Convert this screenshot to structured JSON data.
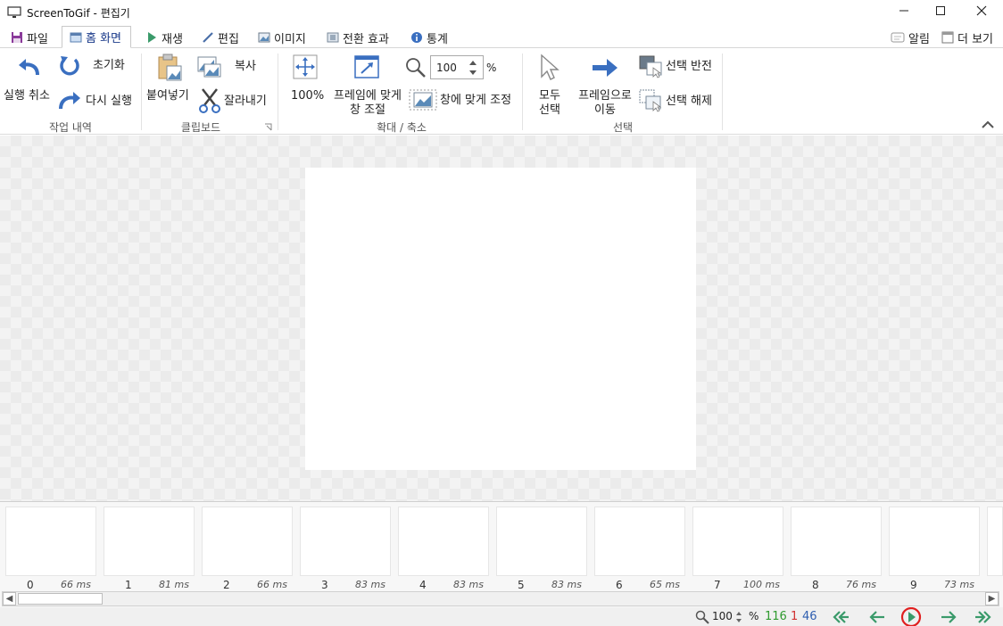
{
  "window": {
    "title": "ScreenToGif - 편집기",
    "icon": "monitor-icon",
    "controls": [
      "minimize-icon",
      "maximize-icon",
      "close-icon"
    ]
  },
  "tabs": [
    {
      "label": "파일",
      "icon": "save-icon"
    },
    {
      "label": "홈 화면",
      "icon": "home-icon",
      "active": true
    },
    {
      "label": "재생",
      "icon": "play-icon"
    },
    {
      "label": "편집",
      "icon": "pencil-icon"
    },
    {
      "label": "이미지",
      "icon": "image-icon"
    },
    {
      "label": "전환 효과",
      "icon": "transition-icon"
    },
    {
      "label": "통계",
      "icon": "info-icon"
    }
  ],
  "right_tabs": [
    {
      "label": "알림",
      "icon": "notification-icon"
    },
    {
      "label": "더 보기",
      "icon": "more-icon"
    }
  ],
  "ribbon": {
    "history": {
      "group_label": "작업 내역",
      "undo": "실행 취소",
      "reset": "초기화",
      "redo": "다시 실행"
    },
    "clipboard": {
      "group_label": "클립보드",
      "paste": "붙여넣기",
      "copy": "복사",
      "cut": "잘라내기"
    },
    "zoom": {
      "group_label": "확대 / 축소",
      "zoom_100": "100%",
      "fit_window_line1": "프레임에 맞게",
      "fit_window_line2": "창 조절",
      "zoom_value": "100",
      "percent": "%",
      "fit_image": "창에 맞게 조정"
    },
    "selection": {
      "group_label": "선택",
      "select_all_line1": "모두",
      "select_all_line2": "선택",
      "go_to_line1": "프레임으로",
      "go_to_line2": "이동",
      "invert": "선택 반전",
      "deselect": "선택 해제"
    }
  },
  "frames": [
    {
      "index": "0",
      "delay": "66 ms"
    },
    {
      "index": "1",
      "delay": "81 ms"
    },
    {
      "index": "2",
      "delay": "66 ms"
    },
    {
      "index": "3",
      "delay": "83 ms"
    },
    {
      "index": "4",
      "delay": "83 ms"
    },
    {
      "index": "5",
      "delay": "83 ms"
    },
    {
      "index": "6",
      "delay": "65 ms"
    },
    {
      "index": "7",
      "delay": "100 ms"
    },
    {
      "index": "8",
      "delay": "76 ms"
    },
    {
      "index": "9",
      "delay": "73 ms"
    }
  ],
  "statusbar": {
    "zoom_value": "100",
    "percent": "%",
    "total_frames": "116",
    "selected_count": "1",
    "current_frame": "46",
    "colors": {
      "total": "#2e9a2e",
      "selected": "#d03030",
      "current": "#2f5fb0"
    }
  },
  "colors": {
    "accent": "#2b6cc4",
    "nav_green": "#3a9a6a",
    "highlight_ring": "#e02020"
  }
}
